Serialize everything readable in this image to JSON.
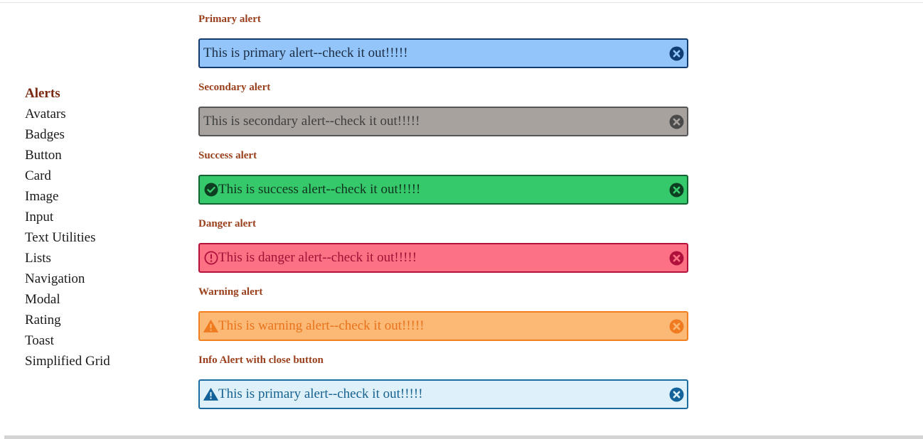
{
  "sidebar": {
    "items": [
      {
        "label": "Alerts",
        "active": true
      },
      {
        "label": "Avatars"
      },
      {
        "label": "Badges"
      },
      {
        "label": "Button"
      },
      {
        "label": "Card"
      },
      {
        "label": "Image"
      },
      {
        "label": "Input"
      },
      {
        "label": "Text Utilities"
      },
      {
        "label": "Lists"
      },
      {
        "label": "Navigation"
      },
      {
        "label": "Modal"
      },
      {
        "label": "Rating"
      },
      {
        "label": "Toast"
      },
      {
        "label": "Simplified Grid"
      }
    ]
  },
  "sections": [
    {
      "title": "Primary alert",
      "message": "This is primary alert--check it out!!!!!",
      "variant": "primary",
      "icon": "none",
      "close_icon": "x-circle-icon"
    },
    {
      "title": "Secondary alert",
      "message": "This is secondary alert--check it out!!!!!",
      "variant": "secondary",
      "icon": "none",
      "close_icon": "x-circle-icon"
    },
    {
      "title": "Success alert",
      "message": "This is success alert--check it out!!!!!",
      "variant": "success",
      "icon": "check-circle-icon",
      "close_icon": "x-circle-icon"
    },
    {
      "title": "Danger alert",
      "message": "This is danger alert--check it out!!!!!",
      "variant": "danger",
      "icon": "exclamation-circle-icon",
      "close_icon": "x-circle-icon"
    },
    {
      "title": "Warning alert",
      "message": "This is warning alert--check it out!!!!!",
      "variant": "warning",
      "icon": "warning-triangle-icon",
      "close_icon": "x-circle-icon"
    },
    {
      "title": "Info Alert with close button",
      "message": "This is primary alert--check it out!!!!!",
      "variant": "info",
      "icon": "warning-triangle-icon",
      "close_icon": "x-circle-icon"
    }
  ],
  "colors": {
    "title": "#9a3f1c",
    "sidebar_active": "#7a2a12",
    "primary": {
      "bg": "#93c5fb",
      "border": "#123a6a",
      "text": "#1b2d44",
      "icon": "#0f3d73"
    },
    "secondary": {
      "bg": "#a8a29e",
      "border": "#555555",
      "text": "#3f3f3f",
      "icon": "#4a4a4a"
    },
    "success": {
      "bg": "#36c96b",
      "border": "#136331",
      "text": "#11331e",
      "icon": "#0d3e22"
    },
    "danger": {
      "bg": "#fc7184",
      "border": "#b5123b",
      "text": "#9e1236",
      "icon": "#b0113c"
    },
    "warning": {
      "bg": "#fbb975",
      "border": "#f37e1e",
      "text": "#e8731d",
      "icon": "#f07a1f"
    },
    "info": {
      "bg": "#def1fb",
      "border": "#1b6aa0",
      "text": "#16618f",
      "icon": "#13639a"
    }
  }
}
